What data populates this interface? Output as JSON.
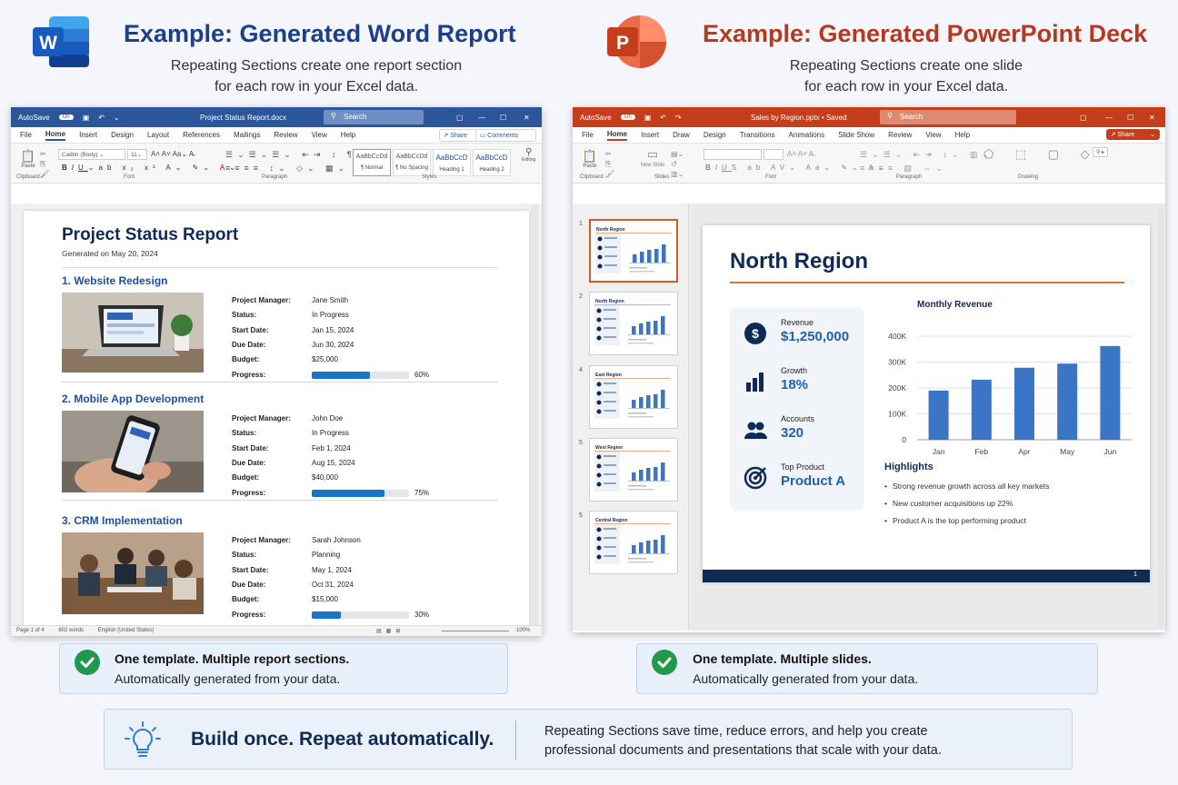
{
  "word_header": {
    "title": "Example: Generated Word Report",
    "subtitle_line1": "Repeating Sections create one report section",
    "subtitle_line2": "for each row in your Excel data.",
    "logo_letter": "W",
    "color": "#1b3f8b"
  },
  "ppt_header": {
    "title": "Example: Generated PowerPoint Deck",
    "subtitle_line1": "Repeating Sections create one slide",
    "subtitle_line2": "for each row in your Excel data.",
    "logo_letter": "P",
    "color": "#b5391f"
  },
  "word_window": {
    "autosave_label": "AutoSave",
    "autosave_state": "On",
    "filename": "Project Status Report.docx",
    "search_placeholder": "Search",
    "share_label": "Share",
    "comments_label": "Comments",
    "menu": [
      "File",
      "Home",
      "Insert",
      "Design",
      "Layout",
      "References",
      "Mailings",
      "Review",
      "View",
      "Help"
    ],
    "active_menu": "Home",
    "font_name": "Calibri (Body)",
    "font_size": "11",
    "styles": [
      {
        "preview": "AaBbCcDd",
        "name": "¶ Normal"
      },
      {
        "preview": "AaBbCcDd",
        "name": "¶ No Spacing"
      },
      {
        "preview": "AaBbCcD",
        "name": "Heading 1"
      },
      {
        "preview": "AaBbCcD",
        "name": "Heading 2"
      }
    ],
    "ribbon_groups": [
      "Clipboard",
      "Font",
      "Paragraph",
      "Styles",
      "Editing"
    ],
    "paste_label": "Paste",
    "status": {
      "page": "Page 1 of 4",
      "words": "602 words",
      "language": "English (United States)",
      "zoom": "100%"
    }
  },
  "report": {
    "title": "Project Status Report",
    "generated": "Generated on May 20, 2024",
    "field_labels": {
      "manager": "Project Manager:",
      "status": "Status:",
      "start": "Start Date:",
      "due": "Due Date:",
      "budget": "Budget:",
      "progress": "Progress:"
    },
    "sections": [
      {
        "heading": "1. Website Redesign",
        "manager": "Jane Smith",
        "status": "In Progress",
        "start": "Jan 15, 2024",
        "due": "Jun 30, 2024",
        "budget": "$25,000",
        "progress": 60,
        "progress_label": "60%"
      },
      {
        "heading": "2. Mobile App Development",
        "manager": "John Doe",
        "status": "In Progress",
        "start": "Feb 1, 2024",
        "due": "Aug 15, 2024",
        "budget": "$40,000",
        "progress": 75,
        "progress_label": "75%"
      },
      {
        "heading": "3. CRM Implementation",
        "manager": "Sarah Johnson",
        "status": "Planning",
        "start": "May 1, 2024",
        "due": "Oct 31, 2024",
        "budget": "$15,000",
        "progress": 30,
        "progress_label": "30%"
      }
    ]
  },
  "ppt_window": {
    "autosave_label": "AutoSave",
    "autosave_state": "On",
    "filename": "Sales by Region.pptx • Saved",
    "search_placeholder": "Search",
    "share_label": "Share",
    "menu": [
      "File",
      "Home",
      "Insert",
      "Draw",
      "Design",
      "Transitions",
      "Animations",
      "Slide Show",
      "Review",
      "View",
      "Help"
    ],
    "active_menu": "Home",
    "ribbon_groups": [
      "Clipboard",
      "Slides",
      "Font",
      "Paragraph",
      "Drawing"
    ],
    "paste_label": "Paste",
    "new_slide_label": "New Slide",
    "thumbnails": [
      {
        "num": "1",
        "title": "North Region"
      },
      {
        "num": "2",
        "title": "North Region"
      },
      {
        "num": "4",
        "title": "East Region"
      },
      {
        "num": "5",
        "title": "West Region"
      },
      {
        "num": "5",
        "title": "Central Region"
      }
    ]
  },
  "slide": {
    "title": "North Region",
    "page_number": "1",
    "kpis": [
      {
        "label": "Revenue",
        "value": "$1,250,000",
        "icon": "dollar-icon"
      },
      {
        "label": "Growth",
        "value": "18%",
        "icon": "bar-chart-icon"
      },
      {
        "label": "Accounts",
        "value": "320",
        "icon": "users-icon"
      },
      {
        "label": "Top Product",
        "value": "Product A",
        "icon": "target-icon"
      }
    ],
    "highlights_title": "Highlights",
    "highlights": [
      "Strong revenue growth across all key markets",
      "New customer acquisitions up 22%",
      "Product A is the top performing product"
    ]
  },
  "chart_data": {
    "type": "bar",
    "title": "Monthly Revenue",
    "categories": [
      "Jan",
      "Feb",
      "Apr",
      "May",
      "Jun"
    ],
    "values": [
      190000,
      232000,
      278000,
      294000,
      362000
    ],
    "ylim": [
      0,
      400000
    ],
    "yticks": [
      "0",
      "100K",
      "200K",
      "300K",
      "400K"
    ],
    "ytick_values": [
      0,
      100000,
      200000,
      300000,
      400000
    ],
    "grid": true,
    "color": "#3b76c4"
  },
  "callouts": {
    "word": {
      "line1": "One template. Multiple report sections.",
      "line2": "Automatically generated from your data."
    },
    "ppt": {
      "line1": "One template. Multiple slides.",
      "line2": "Automatically generated from your data."
    }
  },
  "banner": {
    "headline": "Build once. Repeat automatically.",
    "text_line1": "Repeating Sections save time, reduce errors, and help you create",
    "text_line2": "professional documents and presentations that scale with your data.",
    "icon": "lightbulb-icon"
  }
}
